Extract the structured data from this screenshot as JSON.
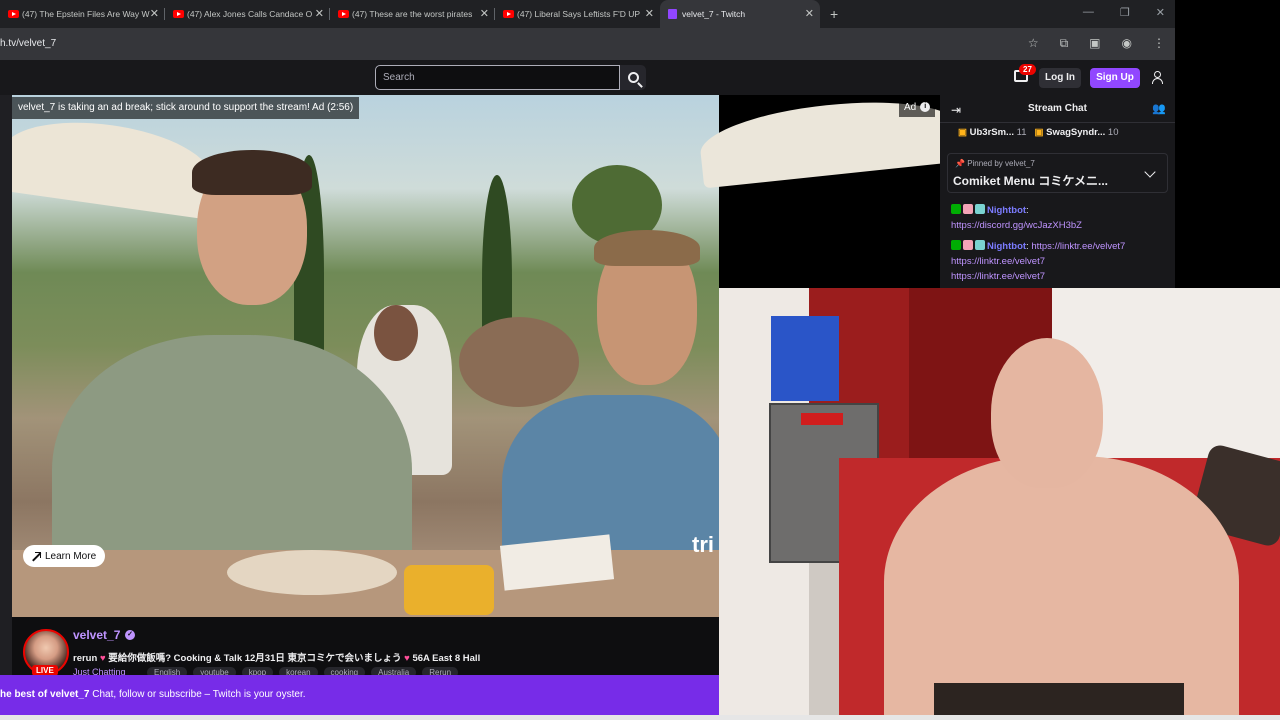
{
  "browser": {
    "tabs": [
      {
        "title": "(47) The Epstein Files Are Way W",
        "icon": "youtube-icon"
      },
      {
        "title": "(47) Alex Jones Calls Candace O",
        "icon": "youtube-icon"
      },
      {
        "title": "(47) These are the worst pirates",
        "icon": "youtube-icon"
      },
      {
        "title": "(47) Liberal Says Leftists F'D UP",
        "icon": "youtube-icon"
      },
      {
        "title": "velvet_7 - Twitch",
        "icon": "twitch-icon",
        "active": true
      }
    ],
    "new_tab": "+",
    "url": "h.tv/velvet_7"
  },
  "twitch_nav": {
    "search_placeholder": "Search",
    "notification_count": "27",
    "login_label": "Log In",
    "signup_label": "Sign Up"
  },
  "player": {
    "ad_break_text": "velvet_7 is taking an ad break; stick around to support the stream! Ad (2:56)",
    "ad_badge": "Ad",
    "learn_more": "Learn More",
    "ad_overlay_text": "tri"
  },
  "channel": {
    "name": "velvet_7",
    "live_label": "LIVE",
    "title_prefix": "rerun",
    "title_main": "要給你做飯嗎? Cooking & Talk 12月31日 東京コミケで会いましょう",
    "title_suffix": "56A East 8 Hall",
    "category": "Just Chatting",
    "tags": [
      "English",
      "youtube",
      "kpop",
      "korean",
      "cooking",
      "Australia",
      "Rerun"
    ]
  },
  "banner": {
    "bold": "he best of velvet_7",
    "text": "Chat, follow or subscribe – Twitch is your oyster."
  },
  "chat": {
    "title": "Stream Chat",
    "gifters": [
      {
        "name": "Ub3rSm...",
        "count": "11"
      },
      {
        "name": "SwagSyndr...",
        "count": "10"
      }
    ],
    "pinned_by_label": "Pinned by",
    "pinned_by_user": "velvet_7",
    "pinned_message": "Comiket Menu コミケメニ...",
    "messages": [
      {
        "user": "Nightbot",
        "sep": ":",
        "text": "",
        "links": [
          "https://discord.gg/wcJazXH3bZ"
        ]
      },
      {
        "user": "Nightbot",
        "sep": ":",
        "text": "https://linktr.ee/velvet7",
        "links": [
          "https://linktr.ee/velvet7",
          "https://linktr.ee/velvet7"
        ]
      }
    ]
  },
  "colors": {
    "twitch_purple": "#9147ff",
    "banner_purple": "#772ce8",
    "live_red": "#eb0400",
    "channel_name": "#bf94ff"
  }
}
